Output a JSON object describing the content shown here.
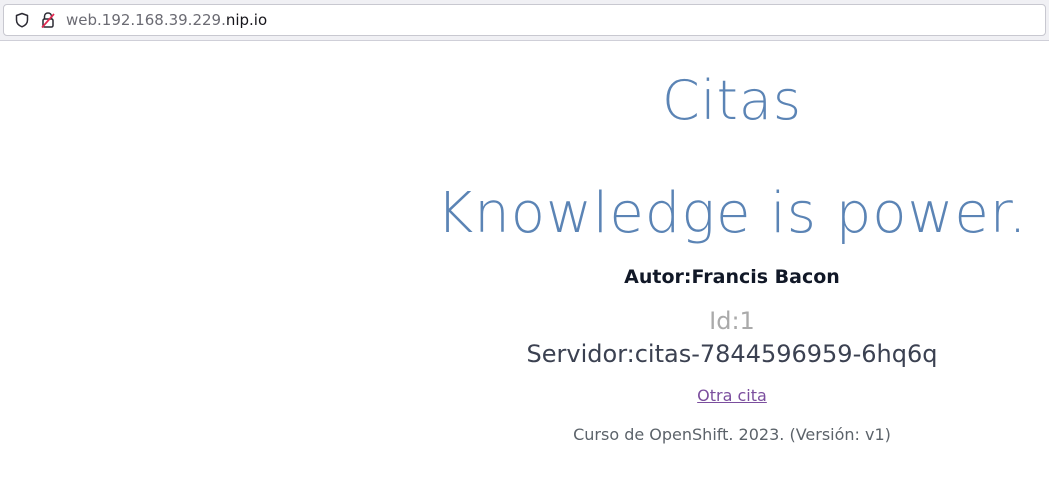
{
  "browser": {
    "url_prefix": "web.192.168.39.229.",
    "url_host": "nip.io",
    "shield_icon": "shield-icon",
    "lock_icon": "insecure-lock-icon"
  },
  "page": {
    "title": "Citas",
    "quote": "Knowledge is power.",
    "author_label": "Autor:",
    "author_name": "Francis Bacon",
    "id_text": "Id:1",
    "server_text": "Servidor:citas-7844596959-6hq6q",
    "another_link": "Otra cita",
    "footer": "Curso de OpenShift. 2023. (Versión: v1)"
  },
  "colors": {
    "title": "#5b84b5",
    "link": "#7b4e9e",
    "id": "#aaaaaa"
  }
}
